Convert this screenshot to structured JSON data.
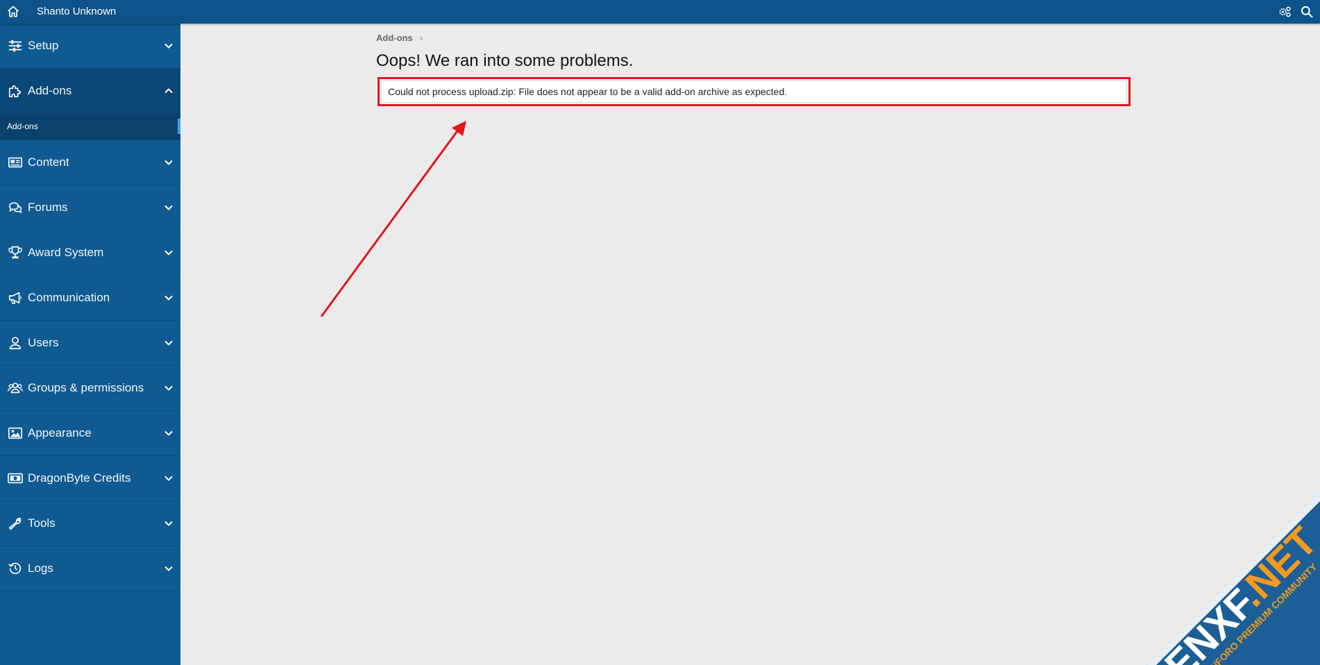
{
  "header": {
    "username": "Shanto Unknown",
    "home_icon": "home-icon",
    "gear_icon": "gears-icon",
    "search_icon": "search-icon"
  },
  "sidebar": {
    "items": [
      {
        "label": "Setup",
        "icon": "sliders-icon"
      },
      {
        "label": "Add-ons",
        "icon": "puzzle-icon"
      },
      {
        "label": "Content",
        "icon": "newspaper-icon"
      },
      {
        "label": "Forums",
        "icon": "comments-icon"
      },
      {
        "label": "Award System",
        "icon": "trophy-icon"
      },
      {
        "label": "Communication",
        "icon": "megaphone-icon"
      },
      {
        "label": "Users",
        "icon": "user-icon"
      },
      {
        "label": "Groups & permissions",
        "icon": "users-icon"
      },
      {
        "label": "Appearance",
        "icon": "image-icon"
      },
      {
        "label": "DragonByte Credits",
        "icon": "money-icon"
      },
      {
        "label": "Tools",
        "icon": "wrench-icon"
      },
      {
        "label": "Logs",
        "icon": "history-icon"
      }
    ],
    "subitems": {
      "addons": "Add-ons"
    }
  },
  "main": {
    "breadcrumb": "Add-ons",
    "breadcrumb_sep": "›",
    "title": "Oops! We ran into some problems.",
    "error": "Could not process upload.zip: File does not appear to be a valid add-on archive as expected."
  },
  "watermark": {
    "brand": "ENXF",
    "brand_suffix": ".NET",
    "tagline": "XENFORO PREMIUM COMMUNITY"
  },
  "colors": {
    "header": "#0d5289",
    "sidebar": "#0f5b91",
    "highlight": "#e4141c",
    "annotation_arrow": "#e4141c"
  }
}
